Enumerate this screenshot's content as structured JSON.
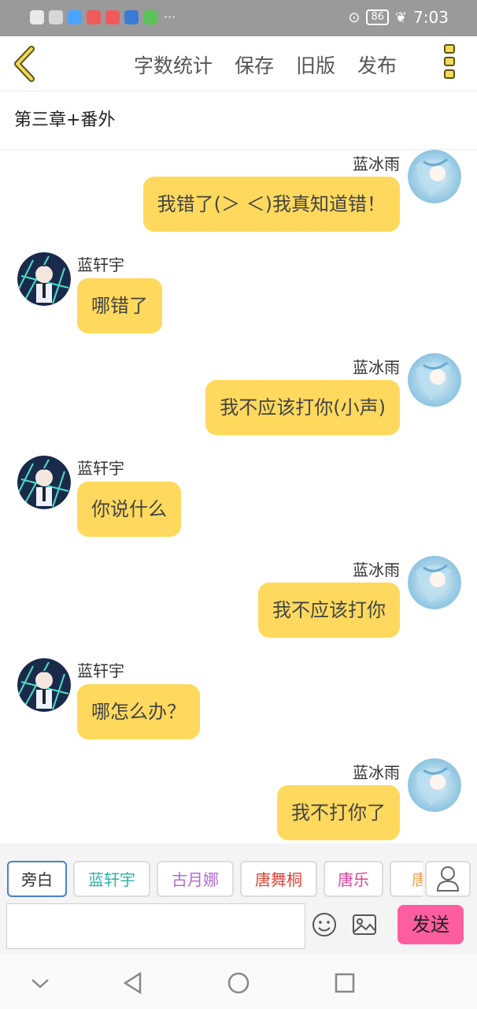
{
  "status_bar": {
    "battery": "86",
    "time": "7:03",
    "dots": "···"
  },
  "toolbar": {
    "actions": [
      "字数统计",
      "保存",
      "旧版",
      "发布"
    ]
  },
  "chapter_title": "第三章+番外",
  "messages": [
    {
      "side": "right",
      "name": "蓝冰雨",
      "text": "我错了(＞ ＜)我真知道错！"
    },
    {
      "side": "left",
      "name": "蓝轩宇",
      "text": "哪错了"
    },
    {
      "side": "right",
      "name": "蓝冰雨",
      "text": "我不应该打你(小声)"
    },
    {
      "side": "left",
      "name": "蓝轩宇",
      "text": "你说什么"
    },
    {
      "side": "right",
      "name": "蓝冰雨",
      "text": "我不应该打你"
    },
    {
      "side": "left",
      "name": "蓝轩宇",
      "text": "哪怎么办？"
    },
    {
      "side": "right",
      "name": "蓝冰雨",
      "text": "我不打你了"
    }
  ],
  "characters": [
    {
      "label": "旁白",
      "color": "#777777"
    },
    {
      "label": "蓝轩宇",
      "color": "#2bb2a6"
    },
    {
      "label": "古月娜",
      "color": "#b36ad1"
    },
    {
      "label": "唐舞桐",
      "color": "#d9453a"
    },
    {
      "label": "唐乐",
      "color": "#e0409a"
    },
    {
      "label": "唐",
      "color": "#f0a050"
    }
  ],
  "compose": {
    "input_value": "",
    "send_label": "发送"
  },
  "colors": {
    "bubble": "#fed95d",
    "send": "#fe5d9f",
    "accent": "#f1d95c"
  }
}
